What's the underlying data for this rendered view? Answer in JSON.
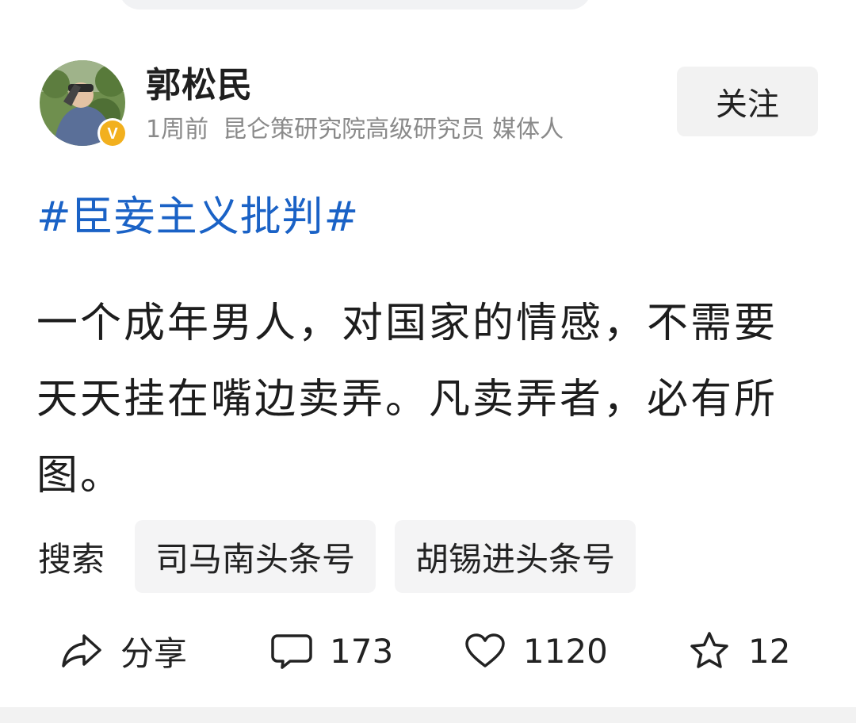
{
  "author": {
    "name": "郭松民",
    "time": "1周前",
    "title": "昆仑策研究院高级研究员",
    "role": "媒体人",
    "verified_badge": "V"
  },
  "follow_label": "关注",
  "post": {
    "hashtag": "#臣妾主义批判#",
    "body": "一个成年男人，对国家的情感，不需要天天挂在嘴边卖弄。凡卖弄者，必有所图。"
  },
  "search": {
    "label": "搜索",
    "chips": [
      "司马南头条号",
      "胡锡进头条号"
    ]
  },
  "actions": {
    "share_label": "分享",
    "comments": "173",
    "likes": "1120",
    "favorites": "12"
  },
  "icons": {
    "share": "share-arrow-icon",
    "comment": "comment-bubble-icon",
    "like": "heart-icon",
    "favorite": "star-icon",
    "verified": "verified-v-badge-icon"
  },
  "colors": {
    "hashtag": "#1a62c6",
    "badge": "#f2b01e",
    "meta_text": "#8a8a8a"
  }
}
